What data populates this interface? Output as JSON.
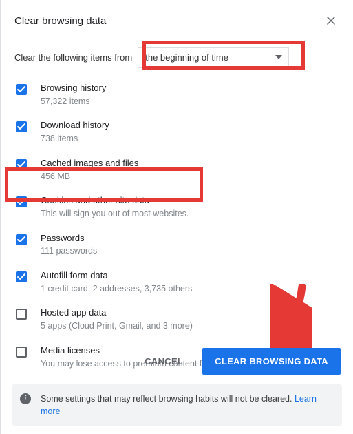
{
  "dialog": {
    "title": "Clear browsing data",
    "range_label": "Clear the following items from",
    "range_value": "the beginning of time"
  },
  "items": [
    {
      "title": "Browsing history",
      "sub": "57,322 items",
      "checked": true
    },
    {
      "title": "Download history",
      "sub": "738 items",
      "checked": true
    },
    {
      "title": "Cached images and files",
      "sub": "456 MB",
      "checked": true
    },
    {
      "title": "Cookies and other site data",
      "sub": "This will sign you out of most websites.",
      "checked": true
    },
    {
      "title": "Passwords",
      "sub": "111 passwords",
      "checked": true
    },
    {
      "title": "Autofill form data",
      "sub": "1 credit card, 2 addresses, 3,735 others",
      "checked": true
    },
    {
      "title": "Hosted app data",
      "sub": "5 apps (Cloud Print, Gmail, and 3 more)",
      "checked": false,
      "hover": true
    },
    {
      "title": "Media licenses",
      "sub": "You may lose access to premium content from some sites.",
      "checked": false
    }
  ],
  "actions": {
    "cancel": "CANCEL",
    "confirm": "CLEAR BROWSING DATA"
  },
  "footer": {
    "text": "Some settings that may reflect browsing habits will not be cleared. ",
    "link": "Learn more"
  },
  "annotations": {
    "highlight_color": "#e53935",
    "arrow_color": "#e53935"
  }
}
